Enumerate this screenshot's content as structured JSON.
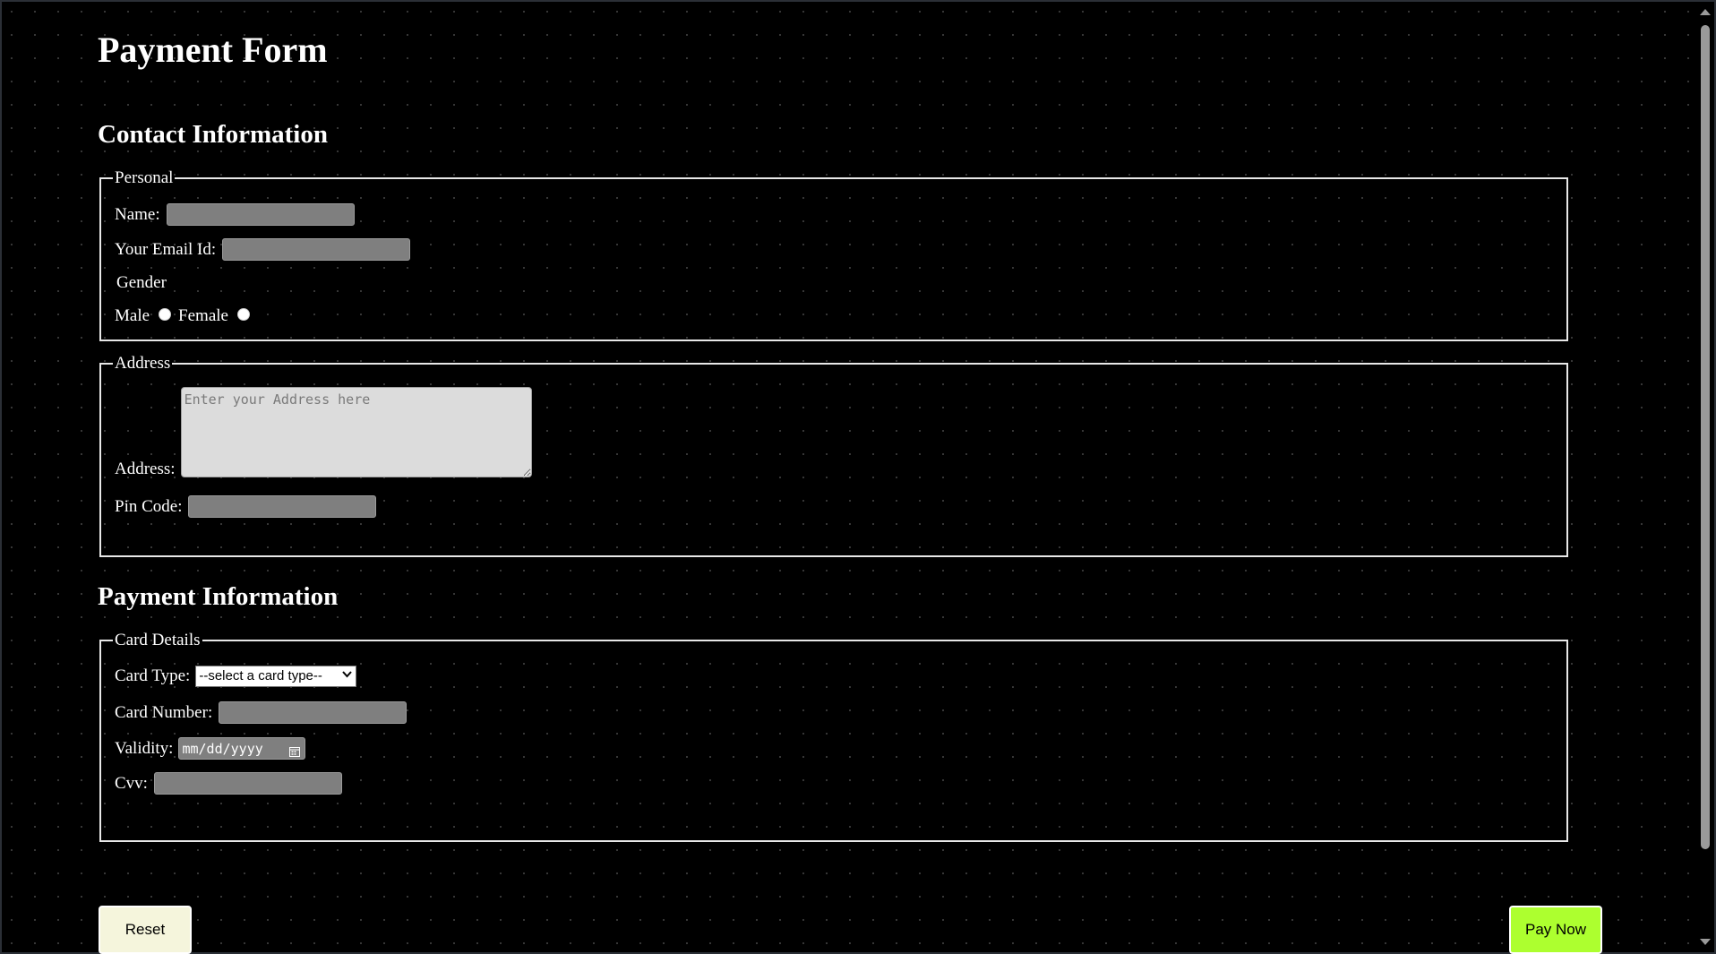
{
  "title": "Payment Form",
  "contact": {
    "heading": "Contact Information",
    "personal": {
      "legend": "Personal",
      "name_label": "Name:",
      "name_value": "",
      "email_label": "Your Email Id:",
      "email_value": "",
      "gender_label": "Gender",
      "male_label": "Male",
      "female_label": "Female"
    },
    "address": {
      "legend": "Address",
      "address_label": "Address:",
      "address_placeholder": "Enter your Address here",
      "pin_label": "Pin Code:",
      "pin_value": ""
    }
  },
  "payment": {
    "heading": "Payment Information",
    "card": {
      "legend": "Card Details",
      "type_label": "Card Type:",
      "type_selected": "--select a card type--",
      "number_label": "Card Number:",
      "number_value": "",
      "validity_label": "Validity:",
      "validity_placeholder": "mm/dd/yyyy",
      "cvv_label": "Cvv:",
      "cvv_value": ""
    }
  },
  "buttons": {
    "reset": "Reset",
    "pay": "Pay Now"
  },
  "colors": {
    "background": "#000000",
    "input_fill": "#7f7f7f",
    "reset_button": "#f5f5dc",
    "pay_button": "#adff2f"
  },
  "icons": {
    "select_arrow": "chevron-down-icon",
    "date_picker": "calendar-icon"
  }
}
